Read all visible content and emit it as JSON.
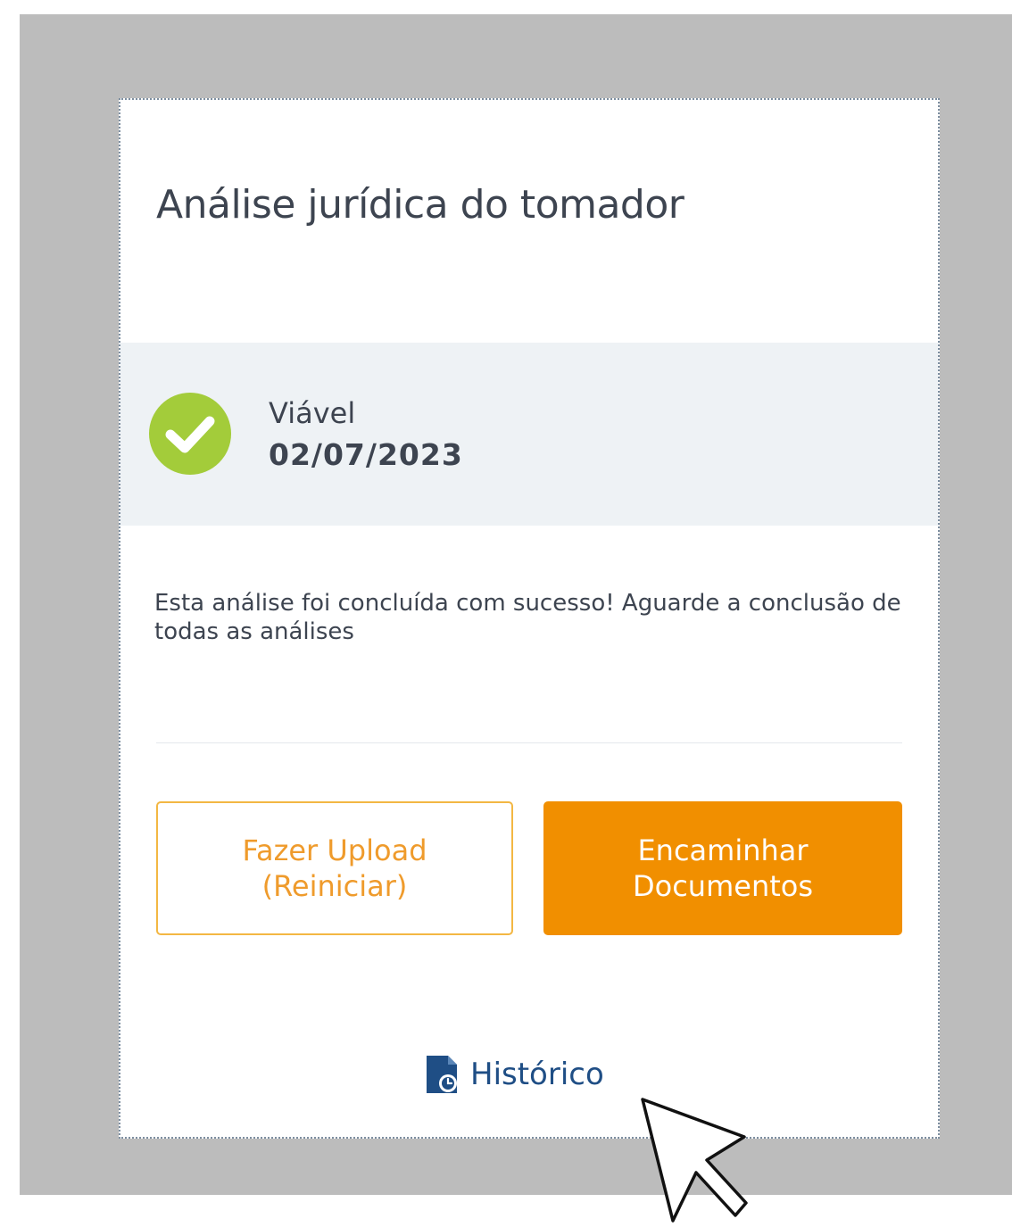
{
  "card": {
    "title": "Análise jurídica do tomador"
  },
  "status": {
    "icon": "check-circle-icon",
    "label": "Viável",
    "date": "02/07/2023",
    "color": "#a3cc3a"
  },
  "message": {
    "text": "Esta análise foi concluída com sucesso! Aguarde a conclusão de todas as análises"
  },
  "buttons": {
    "upload": {
      "line1": "Fazer Upload",
      "line2": "(Reiniciar)"
    },
    "forward": {
      "line1": "Encaminhar",
      "line2": "Documentos"
    }
  },
  "history": {
    "icon": "history-document-icon",
    "label": "Histórico"
  },
  "colors": {
    "accent_orange": "#f18f00",
    "outline_orange": "#f3b743",
    "link_blue": "#1f4e85",
    "band_background": "#eef2f5",
    "text": "#3d4450"
  }
}
